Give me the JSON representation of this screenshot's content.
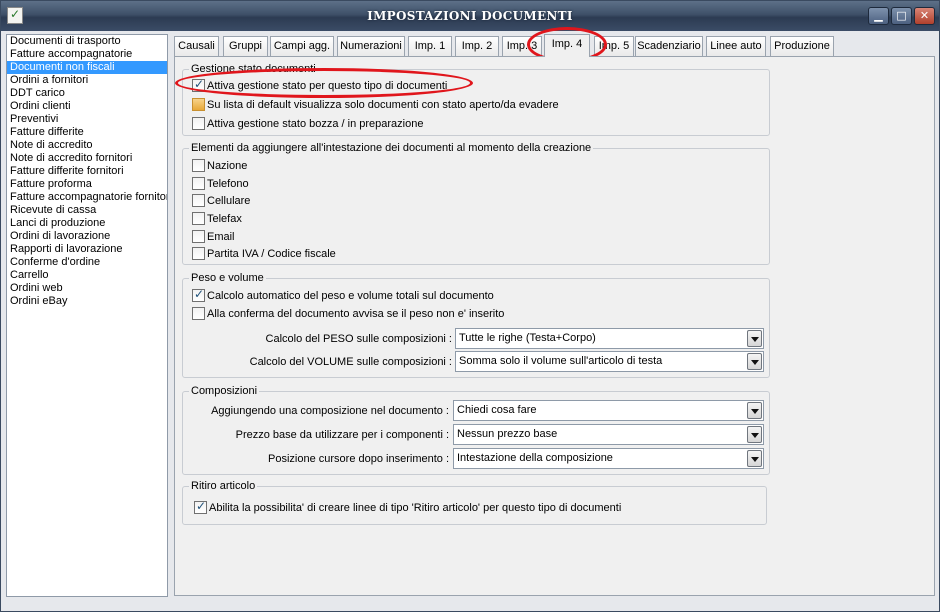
{
  "window": {
    "title": "IMPOSTAZIONI DOCUMENTI",
    "minimize": "▁",
    "maximize": "□",
    "close": "✕"
  },
  "sidebar": {
    "items": [
      "Documenti di trasporto",
      "Fatture accompagnatorie",
      "Documenti non fiscali",
      "Ordini a fornitori",
      "DDT carico",
      "Ordini clienti",
      "Preventivi",
      "Fatture differite",
      "Note di accredito",
      "Note di accredito fornitori",
      "Fatture differite fornitori",
      "Fatture proforma",
      "Fatture accompagnatorie fornitori",
      "Ricevute di cassa",
      "Lanci di produzione",
      "Ordini di lavorazione",
      "Rapporti di lavorazione",
      "Conferme d'ordine",
      "Carrello",
      "Ordini web",
      "Ordini eBay"
    ],
    "selected": "Documenti non fiscali"
  },
  "tabs": [
    "Causali",
    "Gruppi",
    "Campi agg.",
    "Numerazioni",
    "Imp. 1",
    "Imp. 2",
    "Imp. 3",
    "Imp. 4",
    "Imp. 5",
    "Scadenziario",
    "Linee auto",
    "Produzione"
  ],
  "active_tab": "Imp. 4",
  "stato": {
    "legend": "Gestione stato documenti",
    "options": [
      {
        "label": "Attiva gestione stato per questo tipo di documenti",
        "checked": true
      },
      {
        "label": "Su lista di default visualizza solo documenti con stato aperto/da evadere",
        "checked": false
      },
      {
        "label": "Attiva gestione stato bozza / in preparazione",
        "checked": false
      }
    ]
  },
  "intestazione": {
    "legend": "Elementi da aggiungere all'intestazione dei documenti al momento della creazione",
    "options": [
      {
        "label": "Nazione",
        "checked": false
      },
      {
        "label": "Telefono",
        "checked": false
      },
      {
        "label": "Cellulare",
        "checked": false
      },
      {
        "label": "Telefax",
        "checked": false
      },
      {
        "label": "Email",
        "checked": false
      },
      {
        "label": "Partita IVA / Codice fiscale",
        "checked": false
      }
    ]
  },
  "peso": {
    "legend": "Peso e volume",
    "options": [
      {
        "label": "Calcolo automatico del peso e volume totali sul documento",
        "checked": true
      },
      {
        "label": "Alla conferma del documento avvisa se il peso non e' inserito",
        "checked": false
      }
    ],
    "peso_label": "Calcolo del PESO sulle composizioni :",
    "peso_value": "Tutte le righe (Testa+Corpo)",
    "volume_label": "Calcolo del VOLUME sulle composizioni :",
    "volume_value": "Somma solo il volume sull'articolo di testa"
  },
  "composizioni": {
    "legend": "Composizioni",
    "aggiungendo_label": "Aggiungendo una composizione nel documento :",
    "aggiungendo_value": "Chiedi cosa fare",
    "prezzo_label": "Prezzo base da utilizzare per i componenti :",
    "prezzo_value": "Nessun prezzo base",
    "cursore_label": "Posizione cursore dopo inserimento :",
    "cursore_value": "Intestazione della composizione"
  },
  "ritiro": {
    "legend": "Ritiro articolo",
    "option": {
      "label": "Abilita la possibilita' di creare linee di tipo 'Ritiro articolo' per questo tipo di documenti",
      "checked": true
    }
  },
  "colors": {
    "selection": "#3399ff",
    "highlight_ring": "#e0161c",
    "titlebar": "#3e5068"
  }
}
